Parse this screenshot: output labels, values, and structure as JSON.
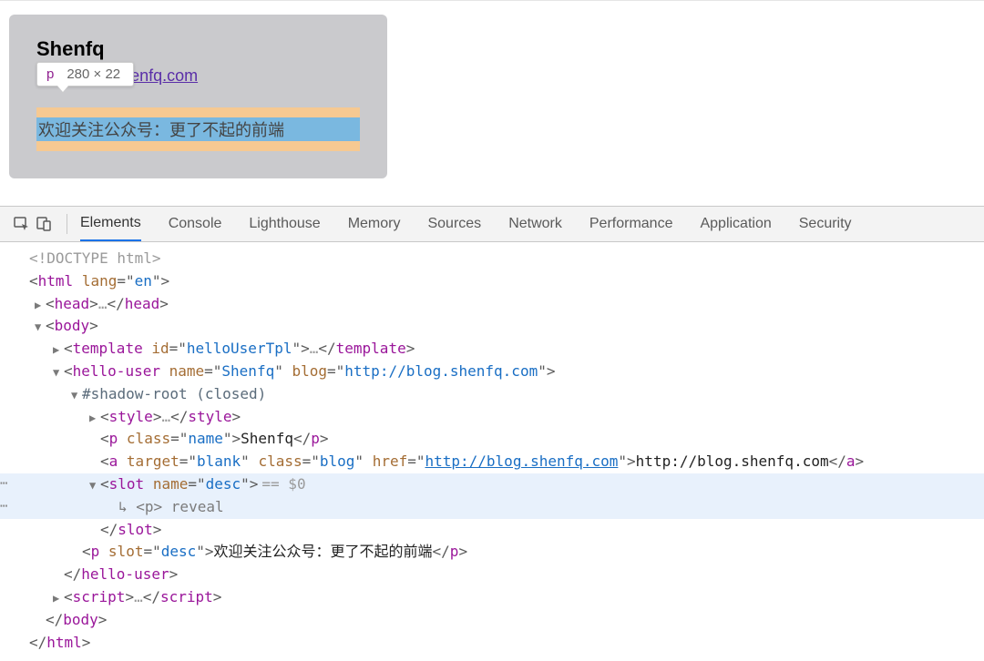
{
  "render": {
    "heading": "Shenfq",
    "link": "http://blog.shenfq.com",
    "slotted": "欢迎关注公众号：更了不起的前端",
    "tooltip_tag": "p",
    "tooltip_dim": "280 × 22"
  },
  "devtools": {
    "tabs": [
      "Elements",
      "Console",
      "Lighthouse",
      "Memory",
      "Sources",
      "Network",
      "Performance",
      "Application",
      "Security"
    ],
    "active_tab": "Elements"
  },
  "dom": {
    "doctype": "<!DOCTYPE html>",
    "html_lang": "en",
    "template_id": "helloUserTpl",
    "hello_user": {
      "name": "Shenfq",
      "blog": "http://blog.shenfq.com"
    },
    "shadow": "#shadow-root (closed)",
    "p_name_class": "name",
    "p_name_text": "Shenfq",
    "a": {
      "target": "blank",
      "class": "blog",
      "href": "http://blog.shenfq.com",
      "text": "http://blog.shenfq.com"
    },
    "slot_name": "desc",
    "slot_eq": "== $0",
    "reveal_label": "↳ <p> reveal",
    "p_slotted": {
      "slot": "desc",
      "text": "欢迎关注公众号：更了不起的前端"
    }
  }
}
